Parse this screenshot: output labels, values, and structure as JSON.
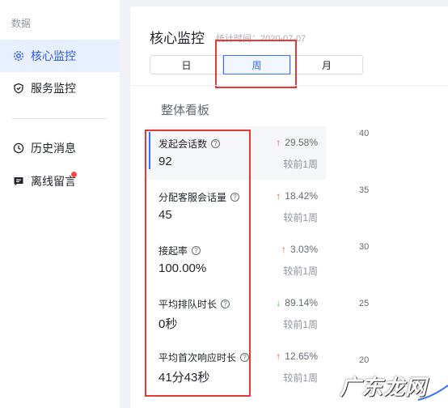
{
  "sidebar": {
    "section_label": "数据",
    "items": [
      {
        "label": "核心监控",
        "icon": "gear-icon",
        "active": true
      },
      {
        "label": "服务监控",
        "icon": "shield-icon"
      },
      {
        "label": "历史消息",
        "icon": "clock-icon"
      },
      {
        "label": "离线留言",
        "icon": "message-icon",
        "has_badge": true
      }
    ]
  },
  "header": {
    "title": "核心监控",
    "stat_time": "统计时间：2020-07-07",
    "periods": [
      "日",
      "周",
      "月"
    ],
    "selected_period": "周"
  },
  "board": {
    "title": "整体看板",
    "metrics": [
      {
        "label": "发起会话数",
        "value": "92",
        "change": "29.58%",
        "direction": "up",
        "compare": "较前1周"
      },
      {
        "label": "分配客服会话量",
        "value": "45",
        "change": "18.42%",
        "direction": "up",
        "compare": "较前1周"
      },
      {
        "label": "接起率",
        "value": "100.00%",
        "change": "3.03%",
        "direction": "up",
        "compare": "较前1周"
      },
      {
        "label": "平均排队时长",
        "value": "0秒",
        "change": "89.14%",
        "direction": "down",
        "compare": "较前1周"
      },
      {
        "label": "平均首次响应时长",
        "value": "41分43秒",
        "change": "12.65%",
        "direction": "up",
        "compare": "较前1周"
      }
    ]
  },
  "chart": {
    "y_ticks": [
      "40",
      "35",
      "30",
      "25",
      "20"
    ]
  },
  "watermark": {
    "text": "广东龙网"
  },
  "colors": {
    "accent": "#3370ff",
    "up": "#f54a45",
    "down": "#34c724",
    "annotation": "#e53935"
  }
}
